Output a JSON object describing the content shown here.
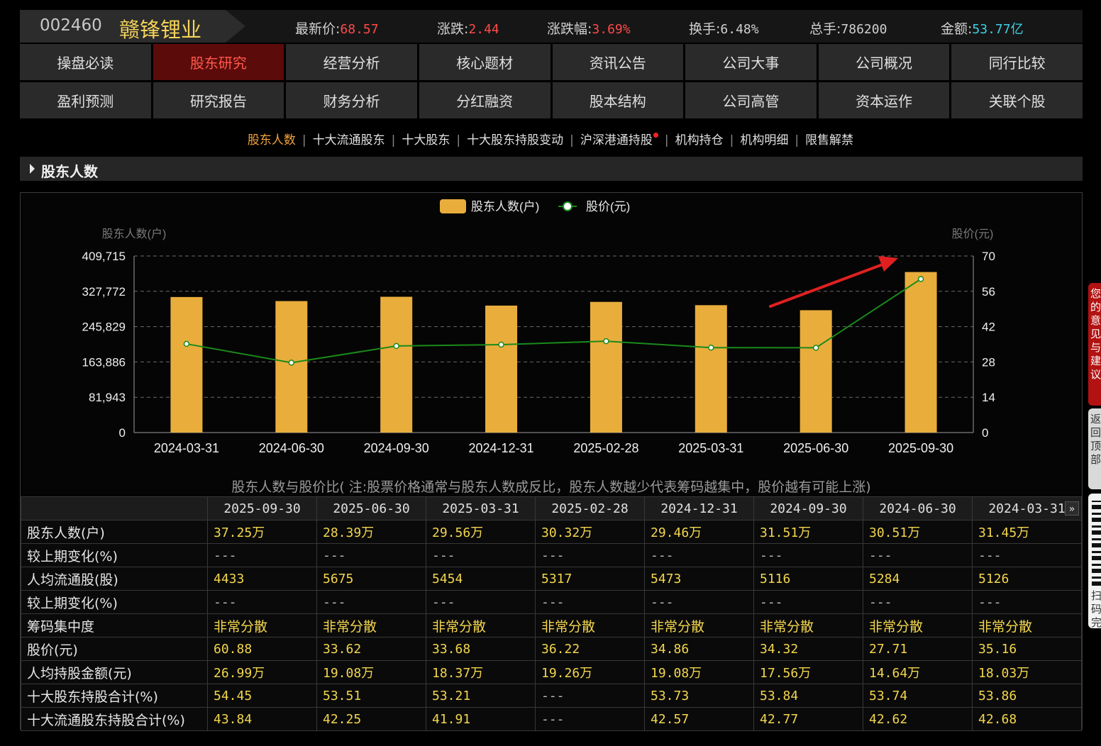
{
  "header": {
    "code": "002460",
    "name": "赣锋锂业",
    "quotes": [
      {
        "label": "最新价:",
        "value": "68.57",
        "color": "#ff4a4a"
      },
      {
        "label": "涨跌:",
        "value": "2.44",
        "color": "#ff4a4a"
      },
      {
        "label": "涨跌幅:",
        "value": "3.69%",
        "color": "#ff4a4a"
      },
      {
        "label": "换手:",
        "value": "6.48%",
        "color": "#d0d0d0"
      },
      {
        "label": "总手:",
        "value": "786200",
        "color": "#d0d0d0"
      },
      {
        "label": "金额:",
        "value": "53.77亿",
        "color": "#3fd0e6"
      }
    ]
  },
  "nav": {
    "row1": [
      "操盘必读",
      "股东研究",
      "经营分析",
      "核心题材",
      "资讯公告",
      "公司大事",
      "公司概况",
      "同行比较"
    ],
    "row2": [
      "盈利预测",
      "研究报告",
      "财务分析",
      "分红融资",
      "股本结构",
      "公司高管",
      "资本运作",
      "关联个股"
    ],
    "active": "股东研究"
  },
  "subnav": {
    "items": [
      "股东人数",
      "十大流通股东",
      "十大股东",
      "十大股东持股变动",
      "沪深港通持股",
      "机构持仓",
      "机构明细",
      "限售解禁"
    ],
    "active": "股东人数",
    "dot_item": "沪深港通持股"
  },
  "section": {
    "title": "股东人数"
  },
  "chart_data": {
    "type": "bar",
    "legend": [
      "股东人数(户)",
      "股价(元)"
    ],
    "left_axis_label": "股东人数(户)",
    "right_axis_label": "股价(元)",
    "categories": [
      "2024-03-31",
      "2024-06-30",
      "2024-09-30",
      "2024-12-31",
      "2025-02-28",
      "2025-03-31",
      "2025-06-30",
      "2025-09-30"
    ],
    "series": [
      {
        "name": "股东人数(户)",
        "type": "bar",
        "color": "#e9ad3c",
        "values": [
          314500,
          305100,
          315100,
          294600,
          303200,
          295600,
          283900,
          372500
        ]
      },
      {
        "name": "股价(元)",
        "type": "line",
        "color": "#1a8a1a",
        "values": [
          35.16,
          27.71,
          34.32,
          34.86,
          36.22,
          33.68,
          33.62,
          60.88
        ]
      }
    ],
    "left_ticks": [
      "0",
      "81,943",
      "163,886",
      "245,829",
      "327,772",
      "409,715"
    ],
    "left_ylim": [
      0,
      409715
    ],
    "right_ticks": [
      "0",
      "14",
      "28",
      "42",
      "56",
      "70"
    ],
    "right_ylim": [
      0,
      70
    ],
    "grid": true,
    "legend_position": "top-center",
    "annotation": "red arrow pointing up-right toward 2025-09-30"
  },
  "chart_note": "股东人数与股价比( 注:股票价格通常与股东人数成反比，股东人数越少代表筹码越集中，股价越有可能上涨)",
  "table": {
    "columns": [
      "2025-09-30",
      "2025-06-30",
      "2025-03-31",
      "2025-02-28",
      "2024-12-31",
      "2024-09-30",
      "2024-06-30",
      "2024-03-31"
    ],
    "rows": [
      {
        "label": "股东人数(户)",
        "values": [
          "37.25万",
          "28.39万",
          "29.56万",
          "30.32万",
          "29.46万",
          "31.51万",
          "30.51万",
          "31.45万"
        ]
      },
      {
        "label": "较上期变化(%)",
        "values": [
          "---",
          "---",
          "---",
          "---",
          "---",
          "---",
          "---",
          "---"
        ]
      },
      {
        "label": "人均流通股(股)",
        "values": [
          "4433",
          "5675",
          "5454",
          "5317",
          "5473",
          "5116",
          "5284",
          "5126"
        ]
      },
      {
        "label": "较上期变化(%)",
        "values": [
          "---",
          "---",
          "---",
          "---",
          "---",
          "---",
          "---",
          "---"
        ]
      },
      {
        "label": "筹码集中度",
        "values": [
          "非常分散",
          "非常分散",
          "非常分散",
          "非常分散",
          "非常分散",
          "非常分散",
          "非常分散",
          "非常分散"
        ]
      },
      {
        "label": "股价(元)",
        "values": [
          "60.88",
          "33.62",
          "33.68",
          "36.22",
          "34.86",
          "34.32",
          "27.71",
          "35.16"
        ]
      },
      {
        "label": "人均持股金额(元)",
        "values": [
          "26.99万",
          "19.08万",
          "18.37万",
          "19.26万",
          "19.08万",
          "17.56万",
          "14.64万",
          "18.03万"
        ]
      },
      {
        "label": "十大股东持股合计(%)",
        "values": [
          "54.45",
          "53.51",
          "53.21",
          "---",
          "53.73",
          "53.84",
          "53.74",
          "53.86"
        ]
      },
      {
        "label": "十大流通股东持股合计(%)",
        "values": [
          "43.84",
          "42.25",
          "41.91",
          "---",
          "42.57",
          "42.77",
          "42.62",
          "42.68"
        ]
      }
    ],
    "more_icon": "»"
  },
  "side": {
    "red_text": "您的意见与建议",
    "gray_text": "返回顶部",
    "qr_text": "扫码完"
  },
  "icons": {
    "section_toggle": "triangle-right-icon",
    "more": "double-chevron-right-icon",
    "qr": "qr-code-icon"
  }
}
